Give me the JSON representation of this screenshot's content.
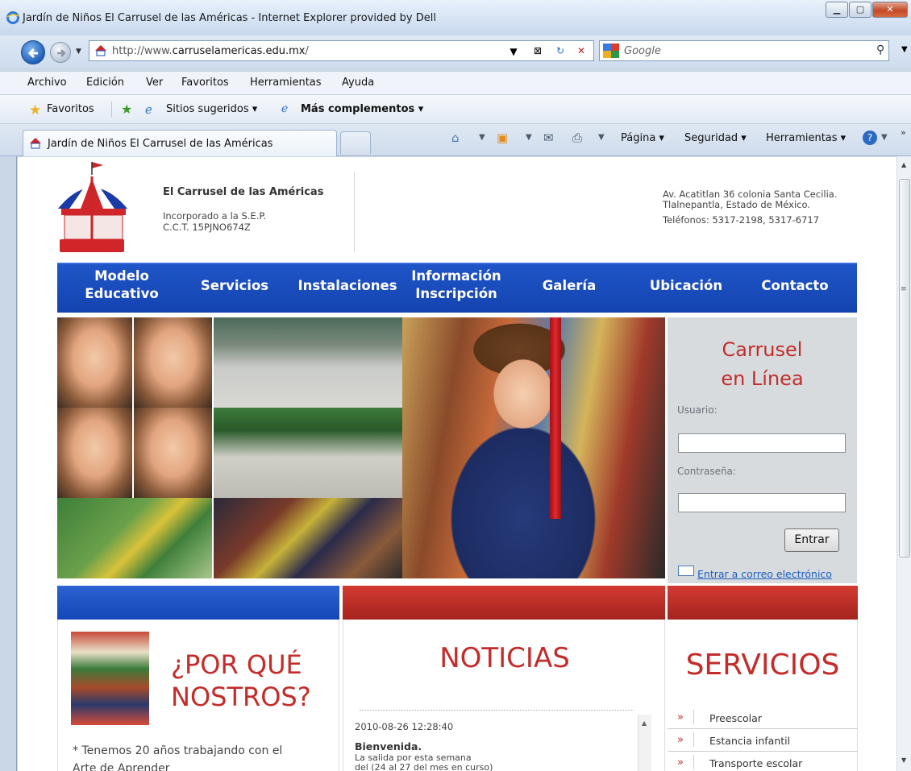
{
  "window": {
    "title": "Jardín de Niños El Carrusel de las Américas - Internet Explorer provided by Dell"
  },
  "address_bar": {
    "url_prefix": "http://www.",
    "url_domain": "carruselamericas.edu.mx",
    "url_suffix": "/",
    "search_placeholder": "Google"
  },
  "menu": [
    "Archivo",
    "Edición",
    "Ver",
    "Favoritos",
    "Herramientas",
    "Ayuda"
  ],
  "favorites_bar": {
    "favorites": "Favoritos",
    "suggested": "Sitios sugeridos ▾",
    "addons": "Más complementos ▾"
  },
  "tab": {
    "title": "Jardín de Niños El Carrusel de las Américas"
  },
  "command_bar": {
    "page": "Página ▾",
    "security": "Seguridad ▾",
    "tools": "Herramientas ▾"
  },
  "site": {
    "name": "El Carrusel de las Américas",
    "incorporated": "Incorporado a la S.E.P.",
    "cct": "C.C.T. 15PJNO674Z",
    "address_line1": "Av. Acatitlan 36 colonia Santa Cecilia.",
    "address_line2": "Tlalnepantla, Estado de México.",
    "phones": "Teléfonos: 5317-2198, 5317-6717",
    "nav": {
      "modelo1": "Modelo",
      "modelo2": "Educativo",
      "servicios": "Servicios",
      "instalaciones": "Instalaciones",
      "info1": "Información",
      "info2": "Inscripción",
      "galeria": "Galería",
      "ubicacion": "Ubicación",
      "contacto": "Contacto"
    },
    "login": {
      "title1": "Carrusel",
      "title2": "en Línea",
      "user_label": "Usuario:",
      "password_label": "Contraseña:",
      "submit": "Entrar",
      "mail_link": "Entrar a correo electrónico"
    },
    "why": {
      "title1": "¿POR QUÉ",
      "title2": "NOSTROS?",
      "text1": "* Tenemos 20 años trabajando con el",
      "text2": "Arte de Aprender"
    },
    "news": {
      "title": "NOTICIAS",
      "date": "2010-08-26 12:28:40",
      "headline": "Bienvenida.",
      "body1": "La salida por esta semana",
      "body2": "del  (24 al 27 del mes en curso)"
    },
    "services": {
      "title": "SERVICIOS",
      "items": [
        "Preescolar",
        "Estancia infantil",
        "Transporte escolar"
      ]
    }
  },
  "colors": {
    "nav_blue": "#1a4cbf",
    "accent_red": "#c32c2a"
  }
}
